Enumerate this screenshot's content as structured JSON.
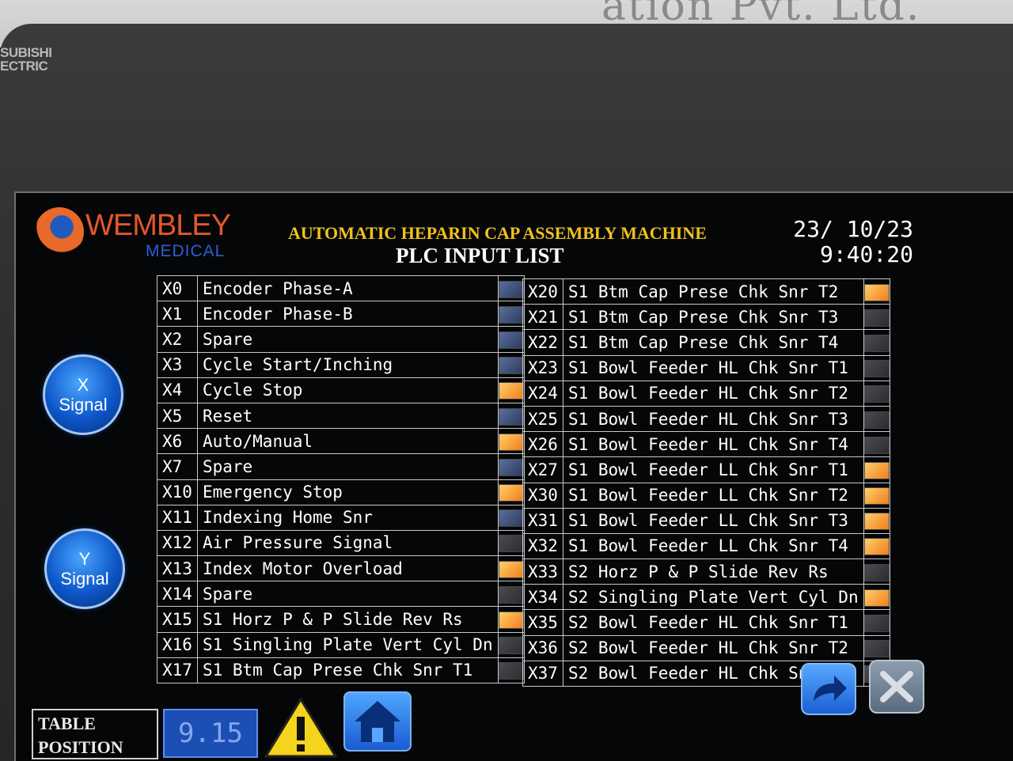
{
  "wall_text": "ation Pvt. Ltd.",
  "bezel_brand": [
    "SUBISHI",
    "ECTRIC"
  ],
  "header": {
    "logo_name": "WEMBLEY",
    "logo_sub": "MEDICAL",
    "title": "AUTOMATIC HEPARIN CAP ASSEMBLY MACHINE",
    "subtitle": "PLC INPUT LIST",
    "date": "23/ 10/23",
    "time": "9:40:20"
  },
  "left_table": [
    {
      "addr": "X0",
      "name": "Encoder Phase-A",
      "state": "off"
    },
    {
      "addr": "X1",
      "name": "Encoder Phase-B",
      "state": "off"
    },
    {
      "addr": "X2",
      "name": "Spare",
      "state": "off"
    },
    {
      "addr": "X3",
      "name": "Cycle Start/Inching",
      "state": "off"
    },
    {
      "addr": "X4",
      "name": "Cycle Stop",
      "state": "on"
    },
    {
      "addr": "X5",
      "name": "Reset",
      "state": "off"
    },
    {
      "addr": "X6",
      "name": "Auto/Manual",
      "state": "on"
    },
    {
      "addr": "X7",
      "name": "Spare",
      "state": "off"
    },
    {
      "addr": "X10",
      "name": "Emergency Stop",
      "state": "on"
    },
    {
      "addr": "X11",
      "name": "Indexing Home Snr",
      "state": "off"
    },
    {
      "addr": "X12",
      "name": "Air Pressure Signal",
      "state": "dim"
    },
    {
      "addr": "X13",
      "name": "Index Motor Overload",
      "state": "on"
    },
    {
      "addr": "X14",
      "name": "Spare",
      "state": "dim"
    },
    {
      "addr": "X15",
      "name": "S1 Horz P & P Slide Rev Rs",
      "state": "on"
    },
    {
      "addr": "X16",
      "name": "S1 Singling Plate Vert Cyl Dn",
      "state": "dim"
    },
    {
      "addr": "X17",
      "name": "S1 Btm Cap Prese Chk Snr T1",
      "state": "dim"
    }
  ],
  "right_table": [
    {
      "addr": "X20",
      "name": "S1 Btm Cap Prese Chk Snr T2",
      "state": "on"
    },
    {
      "addr": "X21",
      "name": "S1 Btm Cap Prese Chk Snr T3",
      "state": "dim"
    },
    {
      "addr": "X22",
      "name": "S1 Btm Cap Prese Chk Snr T4",
      "state": "dim"
    },
    {
      "addr": "X23",
      "name": "S1 Bowl Feeder HL Chk Snr T1",
      "state": "dim"
    },
    {
      "addr": "X24",
      "name": "S1 Bowl Feeder HL Chk Snr T2",
      "state": "dim"
    },
    {
      "addr": "X25",
      "name": "S1 Bowl Feeder HL Chk Snr T3",
      "state": "dim"
    },
    {
      "addr": "X26",
      "name": "S1 Bowl Feeder HL Chk Snr T4",
      "state": "dim"
    },
    {
      "addr": "X27",
      "name": "S1 Bowl Feeder LL Chk Snr T1",
      "state": "on"
    },
    {
      "addr": "X30",
      "name": "S1 Bowl Feeder LL Chk Snr T2",
      "state": "on"
    },
    {
      "addr": "X31",
      "name": "S1 Bowl Feeder LL Chk Snr T3",
      "state": "on"
    },
    {
      "addr": "X32",
      "name": "S1 Bowl Feeder LL Chk Snr T4",
      "state": "on"
    },
    {
      "addr": "X33",
      "name": "S2 Horz P & P Slide Rev Rs",
      "state": "dim"
    },
    {
      "addr": "X34",
      "name": "S2 Singling Plate Vert Cyl Dn",
      "state": "on"
    },
    {
      "addr": "X35",
      "name": "S2 Bowl Feeder HL Chk Snr T1",
      "state": "dim"
    },
    {
      "addr": "X36",
      "name": "S2 Bowl Feeder HL Chk Snr T2",
      "state": "dim"
    },
    {
      "addr": "X37",
      "name": "S2 Bowl Feeder HL Chk Snr T3",
      "state": "dim"
    }
  ],
  "buttons": {
    "x_signal": [
      "X",
      "Signal"
    ],
    "y_signal": [
      "Y",
      "Signal"
    ]
  },
  "footer": {
    "table_position_label": [
      "TABLE",
      "POSITION"
    ],
    "table_position_value": "9.15"
  },
  "colors": {
    "title": "#f0c21a",
    "lamp_on": "#f07d1a",
    "lamp_off": "#2c3a5c",
    "button_blue": "#0d56c8"
  },
  "icons": [
    "warning-icon",
    "home-icon",
    "next-arrow-icon",
    "close-icon"
  ]
}
